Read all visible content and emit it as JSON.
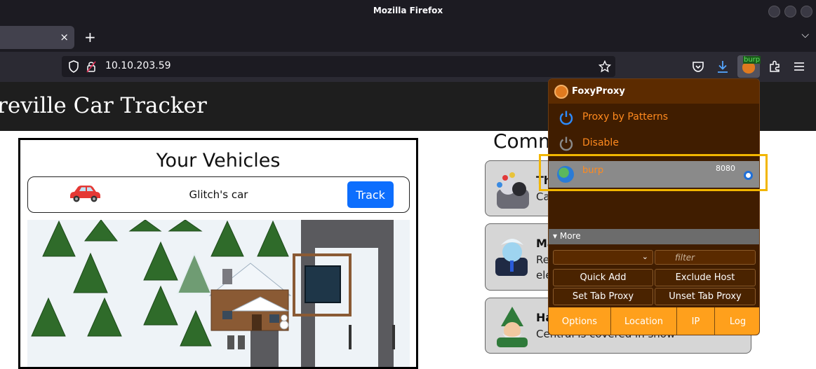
{
  "window": {
    "title": "Mozilla Firefox"
  },
  "tabs": {
    "close_glyph": "×",
    "new_tab_glyph": "+",
    "list_glyph": "⌵"
  },
  "navbar": {
    "url": "10.10.203.59",
    "ext_badge": "burp"
  },
  "page": {
    "site_title": "reville Car Tracker",
    "vehicles_heading": "Your Vehicles",
    "vehicle_name": "Glitch's car",
    "track_label": "Track",
    "comments_heading": "Comm",
    "comments": [
      {
        "name": "Th",
        "text": "Ca"
      },
      {
        "name": "Ma",
        "text": "Re",
        "text2": "ele"
      },
      {
        "name": "Ha",
        "text": "Central is covered in snow"
      }
    ]
  },
  "foxyproxy": {
    "title": "FoxyProxy",
    "mode_patterns": "Proxy by Patterns",
    "mode_disable": "Disable",
    "proxy_name": "burp",
    "proxy_port": "8080",
    "more_label": "▾ More",
    "filter_placeholder": "filter",
    "buttons": {
      "quick_add": "Quick Add",
      "exclude_host": "Exclude Host",
      "set_tab_proxy": "Set Tab Proxy",
      "unset_tab_proxy": "Unset Tab Proxy"
    },
    "footer": {
      "options": "Options",
      "location": "Location",
      "ip": "IP",
      "log": "Log"
    }
  },
  "colors": {
    "accent_orange": "#ff8a1e",
    "highlight": "#f2b600",
    "track_blue": "#0d6efd"
  }
}
